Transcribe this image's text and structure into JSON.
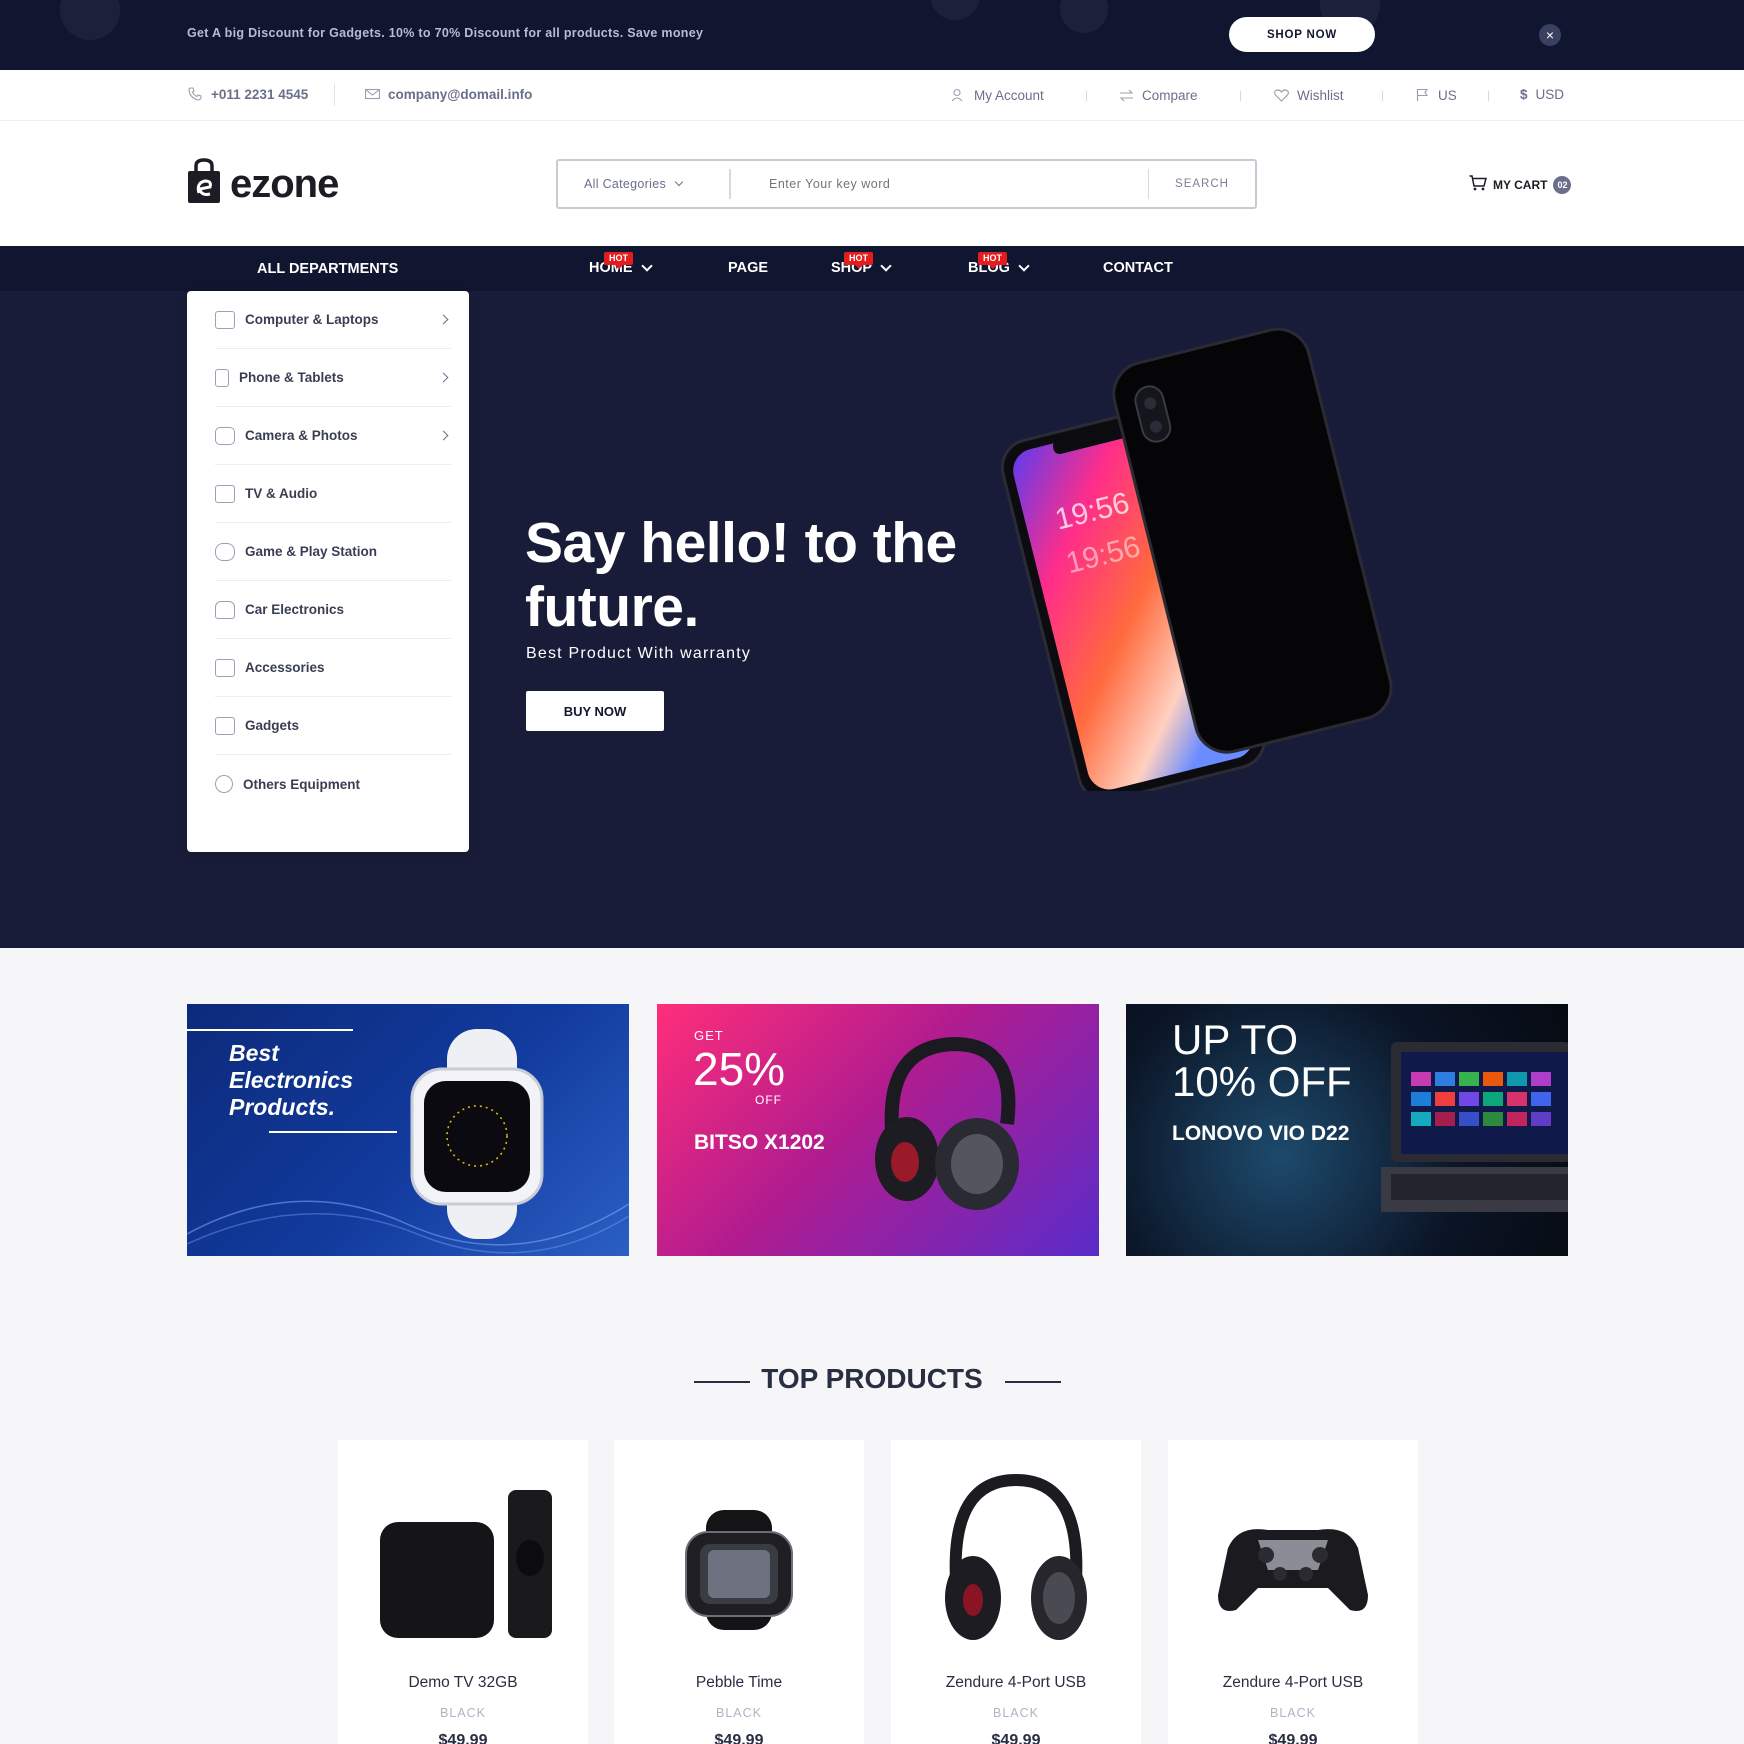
{
  "promo": {
    "text": "Get A big Discount for Gadgets. 10% to 70% Discount for all products. Save money",
    "button": "SHOP NOW",
    "close": "×"
  },
  "util": {
    "phone": "+011 2231 4545",
    "email": "company@domail.info",
    "links": [
      "My Account",
      "Compare",
      "Wishlist",
      "US",
      "USD"
    ]
  },
  "header": {
    "logo": "ezone",
    "search": {
      "category": "All Categories",
      "placeholder": "Enter Your key word",
      "button": "SEARCH"
    },
    "cart": {
      "label": "MY CART",
      "count": "02"
    }
  },
  "nav": {
    "departments": "ALL DEPARTMENTS",
    "items": [
      "HOME",
      "PAGE",
      "SHOP",
      "BLOG",
      "CONTACT"
    ],
    "hot": "HOT"
  },
  "departments": [
    "Computer & Laptops",
    "Phone & Tablets",
    "Camera & Photos",
    "TV & Audio",
    "Game & Play Station",
    "Car Electronics",
    "Accessories",
    "Gadgets",
    "Others Equipment"
  ],
  "hero": {
    "title": "Say hello! to the future.",
    "subtitle": "Best Product With warranty",
    "button": "BUY NOW",
    "phone_time_1": "19:56",
    "phone_time_2": "19:56"
  },
  "banners": {
    "b1": {
      "line1": "Best",
      "line2": "Electronics",
      "line3": "Products."
    },
    "b2": {
      "get": "GET",
      "pct": "25%",
      "off": "OFF",
      "name": "BITSO X1202"
    },
    "b3": {
      "line1": "UP TO",
      "line2": "10% OFF",
      "name": "LONOVO VIO D22"
    }
  },
  "products": {
    "title": "TOP PRODUCTS",
    "items": [
      {
        "name": "Demo TV 32GB",
        "color": "BLACK",
        "price": "$49.99"
      },
      {
        "name": "Pebble Time",
        "color": "BLACK",
        "price": "$49.99"
      },
      {
        "name": "Zendure 4-Port USB",
        "color": "BLACK",
        "price": "$49.99"
      },
      {
        "name": "Zendure 4-Port USB",
        "color": "BLACK",
        "price": "$49.99"
      }
    ]
  },
  "colors": {
    "navy": "#101530",
    "hero_bg": "#181c38",
    "hot_red": "#e31d1d"
  }
}
